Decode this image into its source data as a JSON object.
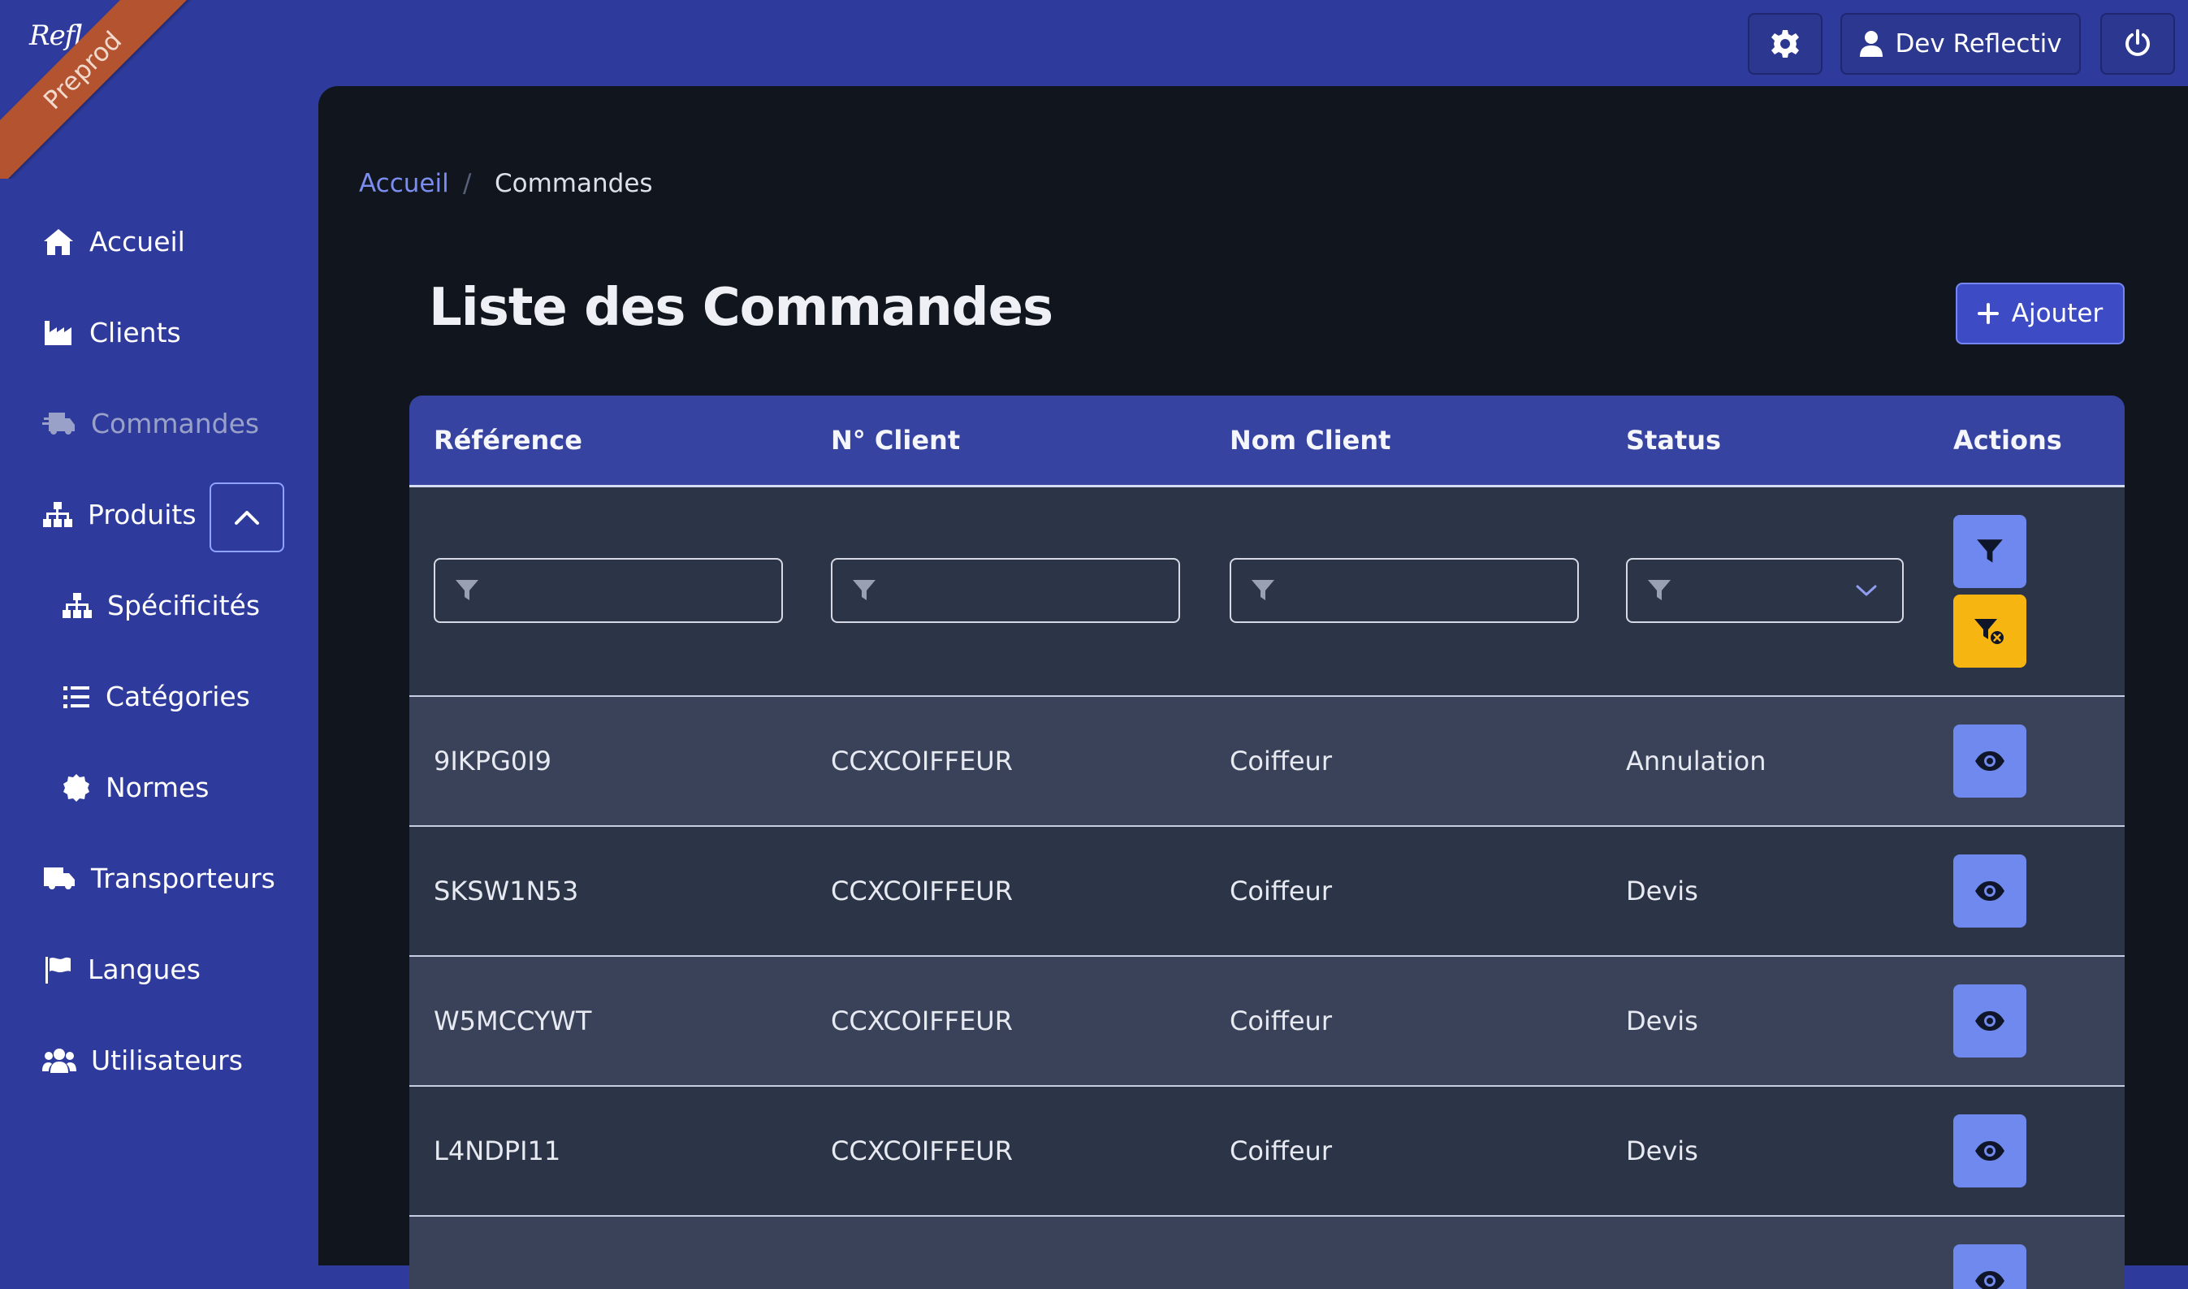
{
  "branding": {
    "logo_text": "Refl",
    "env_badge": "Preprod"
  },
  "topbar": {
    "settings_icon": "gear-icon",
    "user_name": "Dev Reflectiv",
    "user_icon": "user-icon",
    "power_icon": "power-icon"
  },
  "sidebar": {
    "items": [
      {
        "label": "Accueil",
        "icon": "home-icon"
      },
      {
        "label": "Clients",
        "icon": "industry-icon"
      },
      {
        "label": "Commandes",
        "icon": "shipping-fast-icon",
        "active": true
      },
      {
        "label": "Produits",
        "icon": "sitemap-icon",
        "expanded": true
      },
      {
        "label": "Spécificités",
        "icon": "sitemap-icon",
        "sub": true
      },
      {
        "label": "Catégories",
        "icon": "list-icon",
        "sub": true
      },
      {
        "label": "Normes",
        "icon": "certificate-icon",
        "sub": true
      },
      {
        "label": "Transporteurs",
        "icon": "truck-icon"
      },
      {
        "label": "Langues",
        "icon": "flag-icon"
      },
      {
        "label": "Utilisateurs",
        "icon": "users-icon"
      }
    ],
    "toggle_icon": "chevron-up-icon"
  },
  "breadcrumb": {
    "home": "Accueil",
    "separator": "/",
    "current": "Commandes"
  },
  "page": {
    "title": "Liste des Commandes",
    "add_label": "Ajouter"
  },
  "table": {
    "columns": [
      "Référence",
      "N° Client",
      "Nom Client",
      "Status",
      "Actions"
    ],
    "rows": [
      {
        "reference": "9IKPG0I9",
        "client_no": "CCXCOIFFEUR",
        "client_name": "Coiffeur",
        "status": "Annulation"
      },
      {
        "reference": "SKSW1N53",
        "client_no": "CCXCOIFFEUR",
        "client_name": "Coiffeur",
        "status": "Devis"
      },
      {
        "reference": "W5MCCYWT",
        "client_no": "CCXCOIFFEUR",
        "client_name": "Coiffeur",
        "status": "Devis"
      },
      {
        "reference": "L4NDPI11",
        "client_no": "CCXCOIFFEUR",
        "client_name": "Coiffeur",
        "status": "Devis"
      }
    ]
  },
  "colors": {
    "shell": "#2e3b9c",
    "panel": "#11151d",
    "table_header": "#3743a0",
    "primary_button": "#7089ef",
    "warning_button": "#f6b511",
    "ribbon": "#b4532f"
  }
}
